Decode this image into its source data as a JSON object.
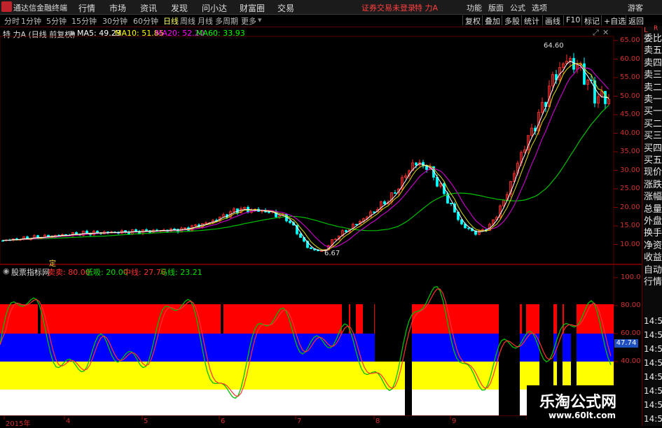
{
  "menubar": {
    "app_name": "通达信金融终端",
    "items": [
      "行情",
      "市场",
      "资讯",
      "发现",
      "问小达",
      "财富圈",
      "交易"
    ],
    "status": "证券交易未登录",
    "stock": "特 力A",
    "right_items": [
      "功能",
      "版面",
      "公式",
      "选项"
    ],
    "user": "游客"
  },
  "tabs": [
    "分时",
    "1分钟",
    "5分钟",
    "15分钟",
    "30分钟",
    "60分钟",
    "日线",
    "周线",
    "月线",
    "多周期",
    "更多"
  ],
  "active_tab": "日线",
  "toolbar": [
    "复权",
    "叠加",
    "多股",
    "统计",
    "画线",
    "F10",
    "标记",
    "+自选",
    "返回"
  ],
  "price_legend": {
    "title": "特 力A (日线 前复权)",
    "ma5": "MA5: 49.23",
    "ma10": "MA10: 51.85",
    "ma20": "MA20: 52.20",
    "ma60": "MA60: 33.93"
  },
  "price_axis": [
    "65.00",
    "60.00",
    "55.00",
    "50.00",
    "45.00",
    "40.00",
    "35.00",
    "30.00",
    "25.00",
    "20.00",
    "15.00",
    "10.00"
  ],
  "annotations": {
    "high": "64.60",
    "low": "6.67"
  },
  "ind_marker": "定",
  "indicator_legend": {
    "name": "股票指标网",
    "sell": "卖卖: 80.00",
    "low": "低吸: 20.00",
    "mid": "中线: 27.76",
    "ma": "马线: 23.21"
  },
  "indicator_axis": [
    "100.0",
    "80.00",
    "60.00",
    "40.00",
    "20.00"
  ],
  "indicator_current": "47.74",
  "right_panel_top": "L",
  "right_panel_top2": "R",
  "right_panel": [
    "委比",
    "卖五",
    "卖四",
    "卖三",
    "卖二",
    "卖一",
    "买一",
    "买二",
    "买三",
    "买四",
    "买五",
    "现价",
    "涨跌",
    "涨幅",
    "总量",
    "外盘",
    "换手",
    "净资",
    "收益",
    "自动",
    "行情"
  ],
  "right_panel_times": [
    "14:50",
    "14:50",
    "14:50",
    "14:50",
    "14:50",
    "14:50",
    "14:50",
    "14:50"
  ],
  "dates": [
    "2015年",
    "4",
    "5",
    "6",
    "7",
    "8",
    "9",
    "10"
  ],
  "watermark": {
    "title": "乐淘公式网",
    "url": "www.60lt.com"
  },
  "colors": {
    "up": "#ff3030",
    "down": "#00ffff",
    "ma5": "#ffffff",
    "ma10": "#ffff00",
    "ma20": "#ff00ff",
    "ma60": "#00ff00"
  }
}
